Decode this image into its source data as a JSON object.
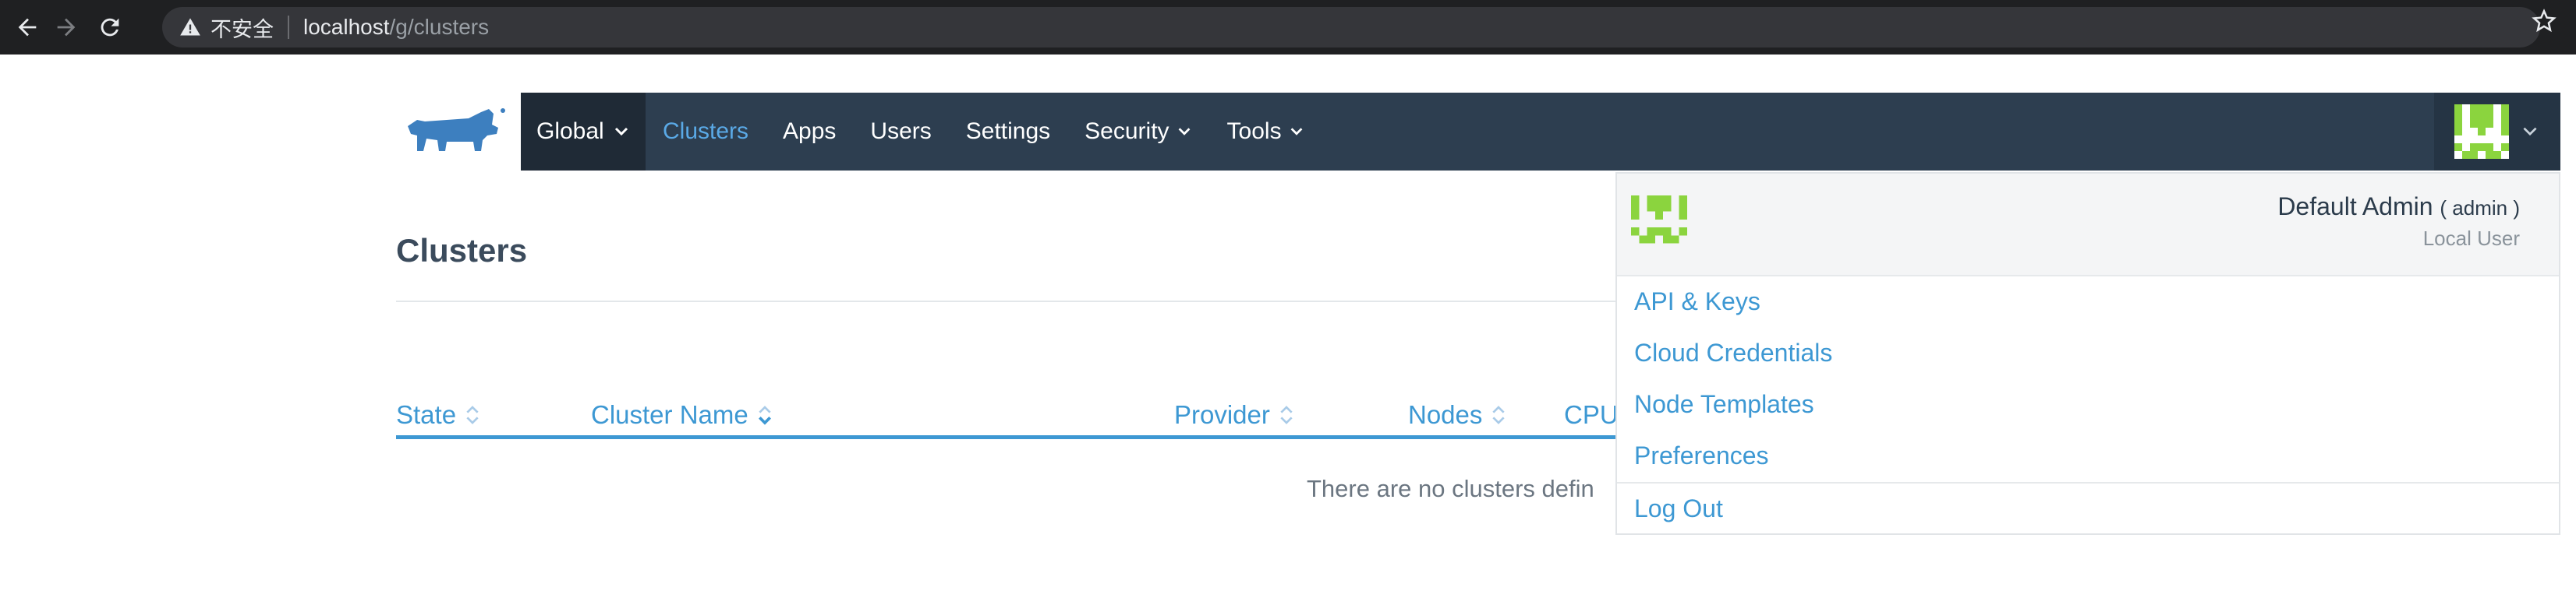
{
  "browser": {
    "warning_text": "不安全",
    "url_host": "localhost",
    "url_path": "/g/clusters"
  },
  "header": {
    "global_label": "Global",
    "nav": [
      {
        "label": "Clusters"
      },
      {
        "label": "Apps"
      },
      {
        "label": "Users"
      },
      {
        "label": "Settings"
      },
      {
        "label": "Security"
      },
      {
        "label": "Tools"
      }
    ]
  },
  "page": {
    "title": "Clusters",
    "columns": [
      "State",
      "Cluster Name",
      "Provider",
      "Nodes",
      "CPU"
    ],
    "empty_message": "There are no clusters defin"
  },
  "user_menu": {
    "name": "Default Admin",
    "username": "( admin )",
    "type": "Local User",
    "items": [
      {
        "label": "API & Keys"
      },
      {
        "label": "Cloud Credentials"
      },
      {
        "label": "Node Templates"
      },
      {
        "label": "Preferences"
      },
      {
        "label": "Log Out"
      }
    ]
  },
  "colors": {
    "header_bg": "#2d3e50",
    "accent": "#3d98d3",
    "avatar_green": "#8bd43e"
  }
}
